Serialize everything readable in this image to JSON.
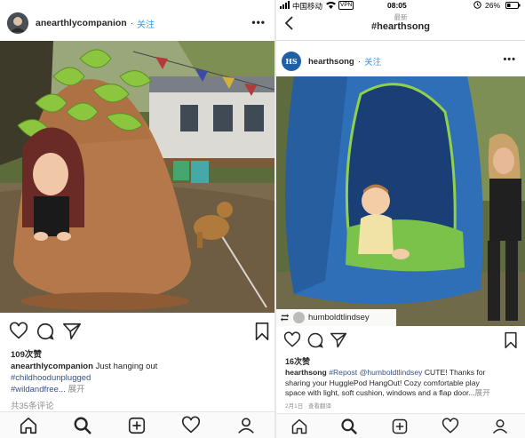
{
  "left": {
    "username": "anearthlycompanion",
    "follow": "关注",
    "dot": "·",
    "more": "•••",
    "likes": "109次赞",
    "caption_user": "anearthlycompanion",
    "caption_text": "Just hanging out",
    "hashtag_1": "#childhoodunplugged",
    "hashtag_2": "#wildandfree...",
    "expand": "展开",
    "comments": "共35条评论"
  },
  "right": {
    "status": {
      "carrier": "中国移动",
      "vpn": "VPN",
      "time": "08:05",
      "battery": "26%"
    },
    "nav": {
      "subtitle": "最新",
      "title": "#hearthsong",
      "back_icon": "chevron-left-icon"
    },
    "username": "hearthsong",
    "avatar_text": "HS",
    "follow": "关注",
    "dot": "·",
    "more": "•••",
    "tagged_user": "humboldtlindsey",
    "likes": "16次赞",
    "caption_user": "hearthsong",
    "caption_tag": "#Repost",
    "caption_mention": "@humboldtlindsey",
    "caption_text_1": "CUTE! Thanks for",
    "caption_text_2": "sharing your HugglePod HangOut! Cozy comfortable play",
    "caption_text_3": "space with light, soft cushion, windows and a flap door...",
    "expand": "展开",
    "date": "2月1日",
    "translate": "查看翻译"
  },
  "colors": {
    "link": "#3897f0",
    "hashtag": "#385185",
    "muted": "#8e8e8e"
  }
}
